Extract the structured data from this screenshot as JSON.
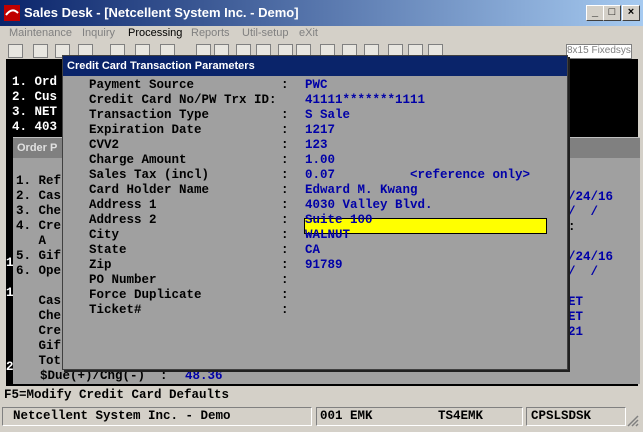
{
  "window": {
    "title": "Sales Desk - [Netcellent System Inc. - Demo]"
  },
  "menu": [
    "Maintenance",
    "Inquiry",
    "Processing",
    "Reports",
    "Util-setup",
    "eXit"
  ],
  "toolbar": {
    "font_label": "8x15 Fixedsys"
  },
  "terminal": {
    "lines": [
      "1. Ord",
      "2. Cus",
      "3. NET",
      "4. 403"
    ]
  },
  "order_panel": {
    "title": "Order P",
    "left_lines": [
      "1. Ref",
      "2. Cas",
      "3. Che",
      "4. Cre",
      "   A",
      "5. Gif",
      "6. Ope",
      "",
      "   Cas",
      "   Che",
      "   Cre",
      "   Gif",
      "   Tot"
    ],
    "right_lines": [
      "/24/16",
      "/  /",
      ":",
      "/24/16",
      "/  /",
      "ET",
      "ET",
      "21"
    ],
    "side_digits": [
      "1",
      "1",
      "2"
    ],
    "due_label": "$Due(+)/Chg(-)  :",
    "due_value": "48.36"
  },
  "dialog": {
    "title": "Credit Card Transaction Parameters",
    "fields": [
      {
        "label": "Payment Source",
        "value": "PWC"
      },
      {
        "label": "Credit Card No/PW Trx ID:",
        "value": "41111*******1111"
      },
      {
        "label": "Transaction Type",
        "value": "S Sale"
      },
      {
        "label": "Expiration Date",
        "value": "1217"
      },
      {
        "label": "CVV2",
        "value": "123"
      },
      {
        "label": "Charge Amount",
        "value": "1.00"
      },
      {
        "label": "Sales Tax (incl)",
        "value": "0.07          <reference only>"
      },
      {
        "label": "Card Holder Name",
        "value": "Edward M. Kwang"
      },
      {
        "label": "Address 1",
        "value": "4030 Valley Blvd."
      },
      {
        "label": "Address 2",
        "value": "Suite 100"
      },
      {
        "label": "City",
        "value": "WALNUT"
      },
      {
        "label": "State",
        "value": "CA"
      },
      {
        "label": "Zip",
        "value": "91789"
      },
      {
        "label": "PO Number",
        "value": ""
      },
      {
        "label": "Force Duplicate",
        "value": ""
      },
      {
        "label": "Ticket#",
        "value": ""
      }
    ]
  },
  "hint": "F5=Modify Credit Card Defaults",
  "status": {
    "company": "Netcellent System Inc. - Demo",
    "user": "001 EMK",
    "station": "TS4EMK",
    "program": "CPSLSDSK"
  },
  "colors": {
    "title_bar": "#0a246a",
    "value_text": "#0000a8",
    "active_field": "#ffff00"
  }
}
